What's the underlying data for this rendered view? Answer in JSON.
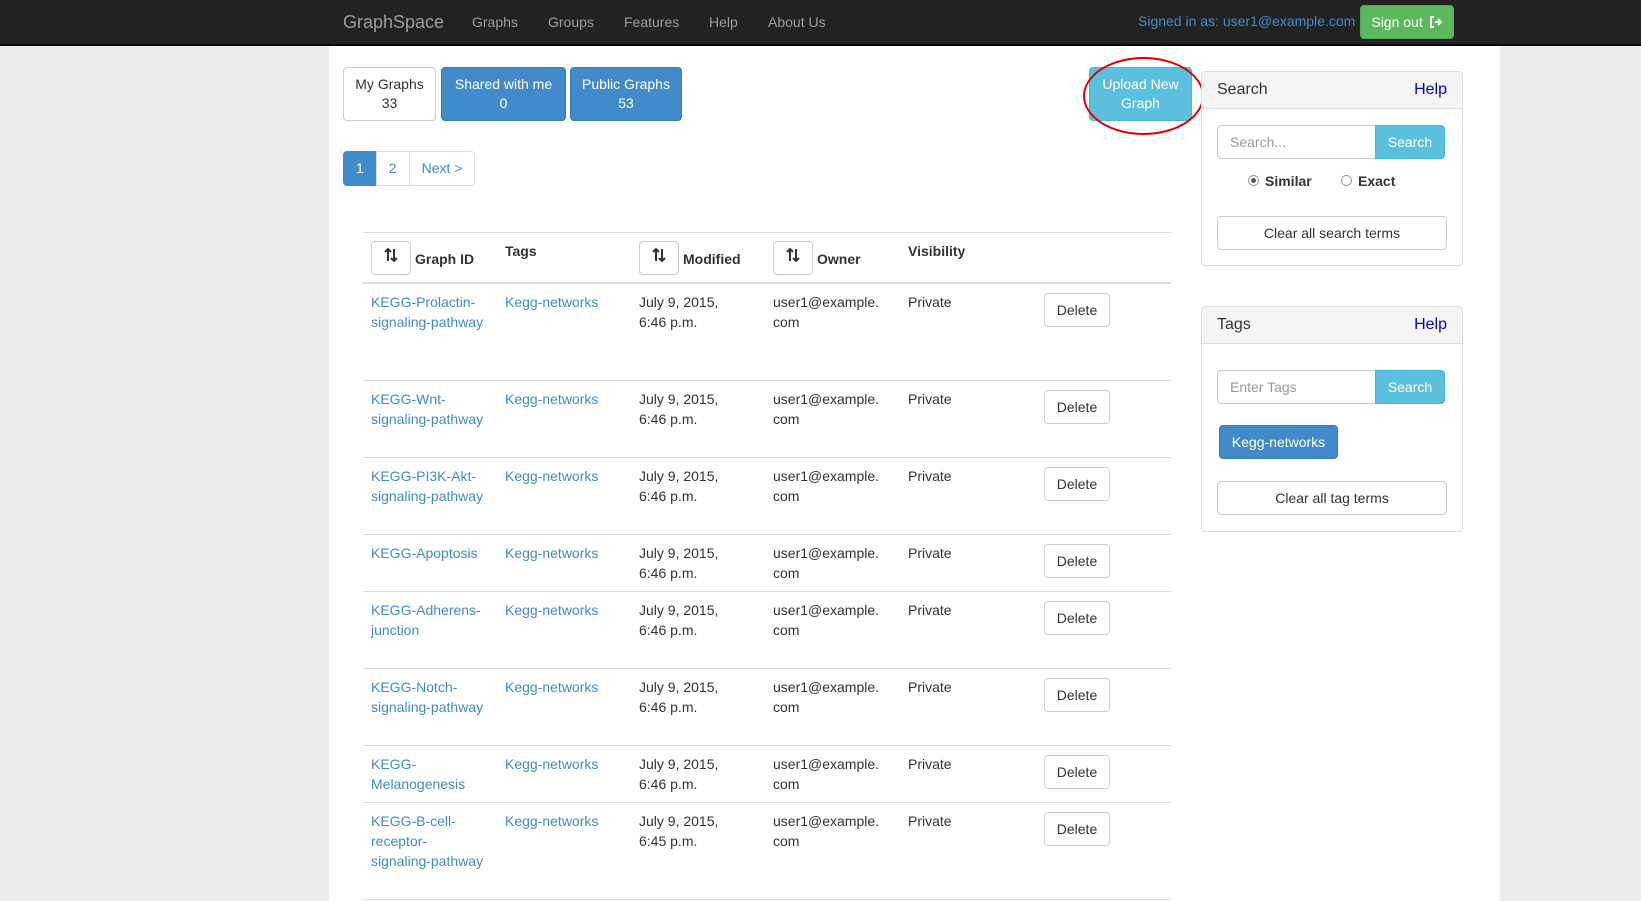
{
  "navbar": {
    "brand": "GraphSpace",
    "items": [
      "Graphs",
      "Groups",
      "Features",
      "Help",
      "About Us"
    ],
    "signed_in": "Signed in as: user1@example.com",
    "signout_label": "Sign out"
  },
  "tabs": [
    {
      "label": "My Graphs",
      "count": "33"
    },
    {
      "label": "Shared with me",
      "count": "0"
    },
    {
      "label": "Public Graphs",
      "count": "53"
    }
  ],
  "upload": {
    "line1": "Upload New",
    "line2": "Graph"
  },
  "pagination": [
    "1",
    "2",
    "Next >"
  ],
  "table": {
    "headers": {
      "id": "Graph ID",
      "tags": "Tags",
      "modified": "Modified",
      "owner": "Owner",
      "visibility": "Visibility"
    },
    "delete_label": "Delete",
    "rows": [
      {
        "id": "KEGG-Prolactin-signaling-pathway",
        "tag": "Kegg-networks",
        "modified": "July 9, 2015, 6:46 p.m.",
        "owner": "user1@example.com",
        "visibility": "Private"
      },
      {
        "id": "KEGG-Wnt-signaling-pathway",
        "tag": "Kegg-networks",
        "modified": "July 9, 2015, 6:46 p.m.",
        "owner": "user1@example.com",
        "visibility": "Private"
      },
      {
        "id": "KEGG-PI3K-Akt-signaling-pathway",
        "tag": "Kegg-networks",
        "modified": "July 9, 2015, 6:46 p.m.",
        "owner": "user1@example.com",
        "visibility": "Private"
      },
      {
        "id": "KEGG-Apoptosis",
        "tag": "Kegg-networks",
        "modified": "July 9, 2015, 6:46 p.m.",
        "owner": "user1@example.com",
        "visibility": "Private"
      },
      {
        "id": "KEGG-Adherens-junction",
        "tag": "Kegg-networks",
        "modified": "July 9, 2015, 6:46 p.m.",
        "owner": "user1@example.com",
        "visibility": "Private"
      },
      {
        "id": "KEGG-Notch-signaling-pathway",
        "tag": "Kegg-networks",
        "modified": "July 9, 2015, 6:46 p.m.",
        "owner": "user1@example.com",
        "visibility": "Private"
      },
      {
        "id": "KEGG-Melanogenesis",
        "tag": "Kegg-networks",
        "modified": "July 9, 2015, 6:46 p.m.",
        "owner": "user1@example.com",
        "visibility": "Private"
      },
      {
        "id": "KEGG-B-cell-receptor-signaling-pathway",
        "tag": "Kegg-networks",
        "modified": "July 9, 2015, 6:45 p.m.",
        "owner": "user1@example.com",
        "visibility": "Private"
      }
    ]
  },
  "search_panel": {
    "title": "Search",
    "help": "Help",
    "placeholder": "Search...",
    "button": "Search",
    "radio_similar": "Similar",
    "radio_exact": "Exact",
    "selected": "Similar",
    "clear": "Clear all search terms"
  },
  "tags_panel": {
    "title": "Tags",
    "help": "Help",
    "placeholder": "Enter Tags",
    "button": "Search",
    "chip": "Kegg-networks",
    "clear": "Clear all tag terms"
  },
  "colors": {
    "navbar": "#222222",
    "primary": "#428bca",
    "info": "#5bc0de",
    "success": "#5cb85c",
    "highlight": "#e00000"
  }
}
